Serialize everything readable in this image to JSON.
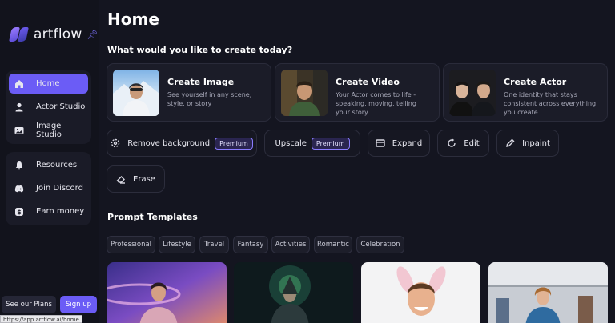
{
  "app": {
    "logo_text": "artflow"
  },
  "sidebar": {
    "primary": [
      {
        "label": "Home",
        "icon": "home-icon",
        "active": true
      },
      {
        "label": "Actor Studio",
        "icon": "user-icon"
      },
      {
        "label": "Image Studio",
        "icon": "image-icon"
      }
    ],
    "secondary": [
      {
        "label": "Resources",
        "icon": "bell-icon"
      },
      {
        "label": "Join Discord",
        "icon": "discord-icon"
      },
      {
        "label": "Earn money",
        "icon": "dollar-icon"
      }
    ],
    "see_plans": "See our Plans",
    "sign_up": "Sign up"
  },
  "status_url": "https://app.artflow.ai/home",
  "main": {
    "title": "Home",
    "create_heading": "What would you like to create today?",
    "cards": [
      {
        "title": "Create Image",
        "desc": "See yourself in any scene, style, or story"
      },
      {
        "title": "Create Video",
        "desc": "Your Actor comes to life - speaking, moving, telling your story"
      },
      {
        "title": "Create Actor",
        "desc": "One identity that stays consistent across everything you create"
      }
    ],
    "tools": [
      {
        "label": "Remove background",
        "badge": "Premium"
      },
      {
        "label": "Upscale",
        "badge": "Premium"
      },
      {
        "label": "Expand"
      },
      {
        "label": "Edit"
      },
      {
        "label": "Inpaint"
      },
      {
        "label": "Erase"
      }
    ],
    "templates_heading": "Prompt Templates",
    "chips": [
      "Professional",
      "Lifestyle",
      "Travel",
      "Fantasy",
      "Activities",
      "Romantic",
      "Celebration"
    ]
  },
  "colors": {
    "accent": "#6b5cf6",
    "background": "#141520",
    "sidebar": "#12131c"
  }
}
